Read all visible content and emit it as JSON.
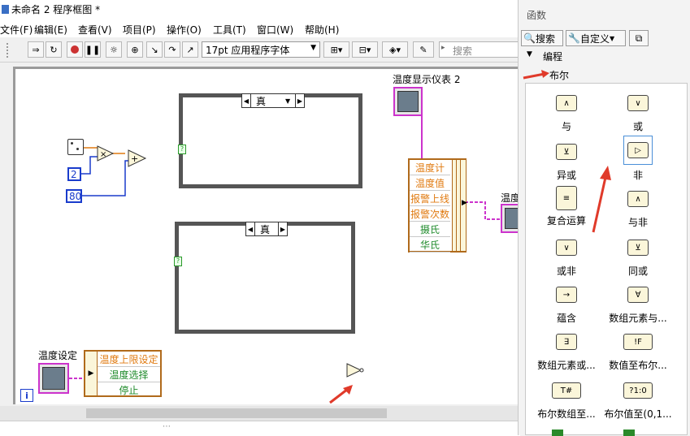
{
  "window": {
    "title": "未命名 2 程序框图 *"
  },
  "menu": [
    "文件(F)",
    "编辑(E)",
    "查看(V)",
    "项目(P)",
    "操作(O)",
    "工具(T)",
    "窗口(W)",
    "帮助(H)"
  ],
  "toolbar": {
    "font_select": "17pt 应用程序字体",
    "search_placeholder": "搜索"
  },
  "diagram": {
    "case1_selector": "真",
    "case2_selector": "真",
    "const_a": "2",
    "const_b": "80",
    "display_label": "温度显示仪表 2",
    "display_label_right": "温度",
    "cluster_rows": [
      {
        "text": "温度计",
        "color": "orange"
      },
      {
        "text": "温度值",
        "color": "orange"
      },
      {
        "text": "报警上线",
        "color": "orange"
      },
      {
        "text": "报警次数",
        "color": "orange"
      },
      {
        "text": "摄氏",
        "color": "green"
      },
      {
        "text": "华氏",
        "color": "green"
      }
    ],
    "settings_label": "温度设定",
    "settings_rows": [
      {
        "text": "温度上限设定",
        "color": "orange"
      },
      {
        "text": "温度选择",
        "color": "green"
      },
      {
        "text": "停止",
        "color": "green"
      }
    ],
    "info_glyph": "i"
  },
  "palette": {
    "title": "函数",
    "search_btn": "搜索",
    "custom_btn": "自定义",
    "tree_programming": "编程",
    "tree_boolean": "布尔",
    "items": [
      {
        "label": "与",
        "glyph": "∧"
      },
      {
        "label": "或",
        "glyph": "∨"
      },
      {
        "label": "异或",
        "glyph": "⊻"
      },
      {
        "label": "非",
        "glyph": "▷"
      },
      {
        "label": "复合运算",
        "glyph": "≡"
      },
      {
        "label": "与非",
        "glyph": "∧"
      },
      {
        "label": "或非",
        "glyph": "∨"
      },
      {
        "label": "同或",
        "glyph": "⊻"
      },
      {
        "label": "蕴含",
        "glyph": "→"
      },
      {
        "label": "数组元素与...",
        "glyph": "∀"
      },
      {
        "label": "数组元素或...",
        "glyph": "∃"
      },
      {
        "label": "数值至布尔...",
        "glyph": "!F"
      },
      {
        "label": "布尔数组至...",
        "glyph": "T#"
      },
      {
        "label": "布尔值至(0,1...",
        "glyph": "?1:0"
      }
    ]
  }
}
